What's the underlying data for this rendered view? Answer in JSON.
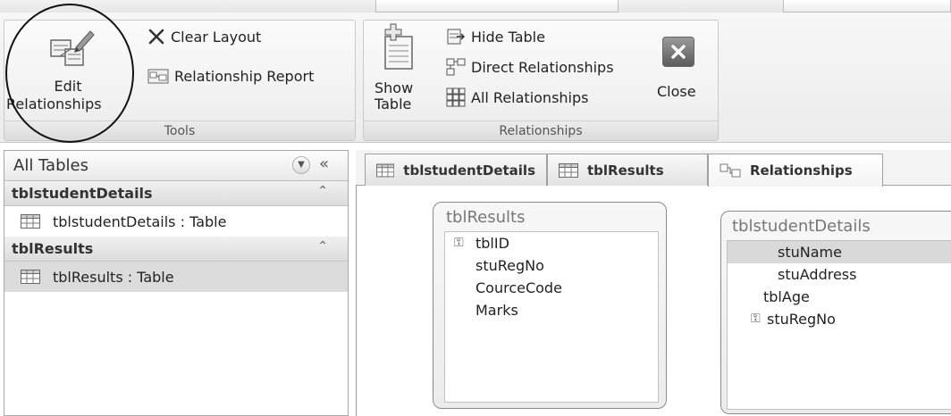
{
  "ribbon": {
    "tools_group": {
      "label": "Tools",
      "edit_relationships_line1": "Edit",
      "edit_relationships_line2": "Relationships",
      "clear_layout": "Clear Layout",
      "relationship_report": "Relationship Report"
    },
    "relationships_group": {
      "label": "Relationships",
      "show_table_line1": "Show",
      "show_table_line2": "Table",
      "hide_table": "Hide Table",
      "direct_relationships": "Direct Relationships",
      "all_relationships": "All Relationships",
      "close": "Close"
    }
  },
  "nav": {
    "title": "All Tables",
    "groups": [
      {
        "title": "tblstudentDetails",
        "item": "tblstudentDetails : Table"
      },
      {
        "title": "tblResults",
        "item": "tblResults : Table"
      }
    ]
  },
  "doc_tabs": [
    {
      "label": "tblstudentDetails",
      "icon": "table-icon"
    },
    {
      "label": "tblResults",
      "icon": "table-icon"
    },
    {
      "label": "Relationships",
      "icon": "relationships-icon"
    }
  ],
  "tables": [
    {
      "title": "tblResults",
      "fields": [
        {
          "name": "tblID",
          "key": true
        },
        {
          "name": "stuRegNo",
          "key": false
        },
        {
          "name": "CourceCode",
          "key": false
        },
        {
          "name": "Marks",
          "key": false
        }
      ]
    },
    {
      "title": "tblstudentDetails",
      "fields": [
        {
          "name": "stuName",
          "key": false,
          "selected": true
        },
        {
          "name": "stuAddress",
          "key": false
        },
        {
          "name": "tblAge",
          "key": false
        },
        {
          "name": "stuRegNo",
          "key": true
        }
      ]
    }
  ]
}
